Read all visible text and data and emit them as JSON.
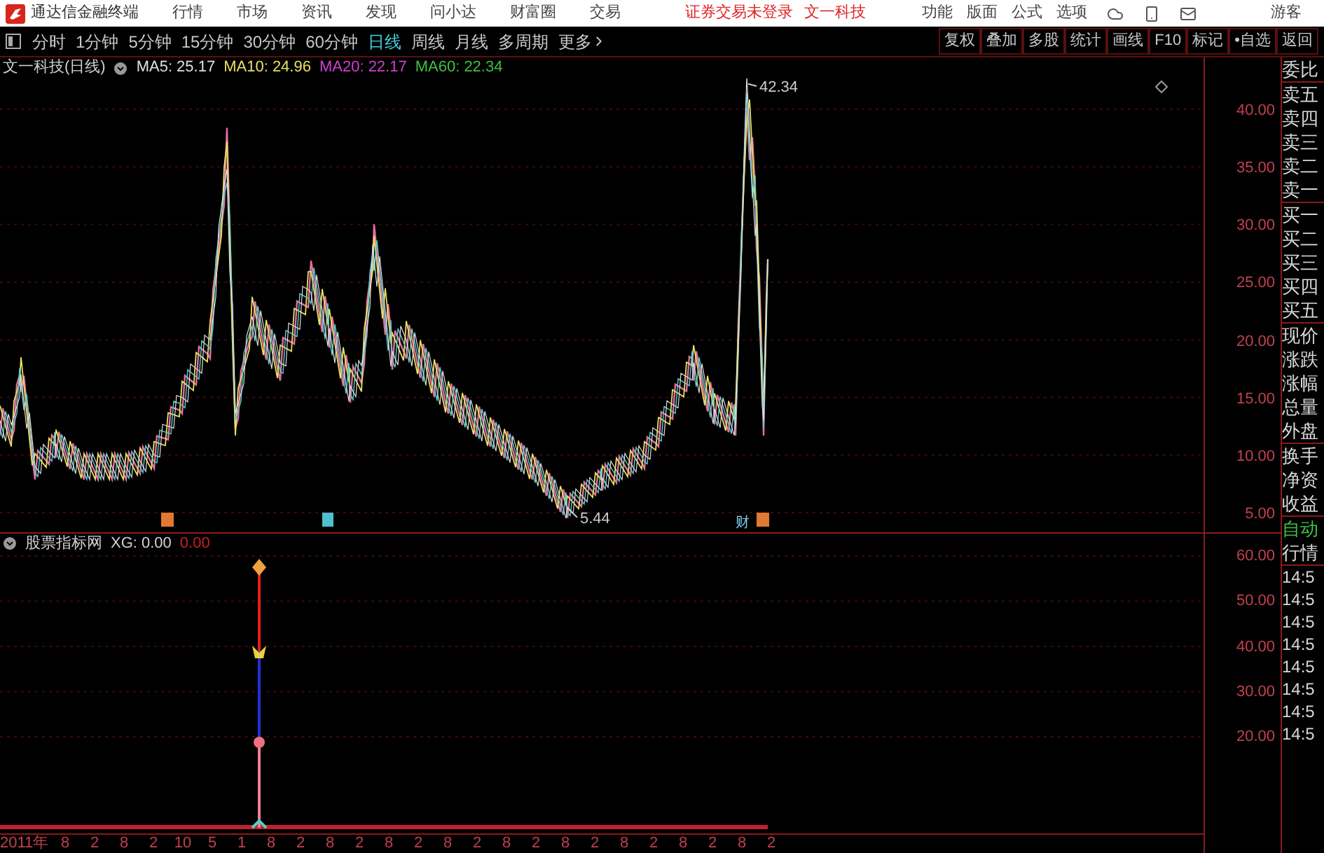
{
  "title_bar": {
    "app_name": "通达信金融终端",
    "menu": [
      "行情",
      "市场",
      "资讯",
      "发现",
      "问小达",
      "财富圈",
      "交易"
    ],
    "notice": "证券交易未登录",
    "stock": "文一科技",
    "tools": [
      "功能",
      "版面",
      "公式",
      "选项"
    ],
    "user": "游客"
  },
  "toolbar": {
    "periods": [
      {
        "label": "分时",
        "selected": false
      },
      {
        "label": "1分钟",
        "selected": false
      },
      {
        "label": "5分钟",
        "selected": false
      },
      {
        "label": "15分钟",
        "selected": false
      },
      {
        "label": "30分钟",
        "selected": false
      },
      {
        "label": "60分钟",
        "selected": false
      },
      {
        "label": "日线",
        "selected": true
      },
      {
        "label": "周线",
        "selected": false
      },
      {
        "label": "月线",
        "selected": false
      },
      {
        "label": "多周期",
        "selected": false
      }
    ],
    "more": "更多",
    "actions": [
      "复权",
      "叠加",
      "多股",
      "统计",
      "画线",
      "F10",
      "标记",
      "•自选",
      "返回"
    ]
  },
  "main_chart": {
    "title": "文一科技(日线)",
    "ma": [
      {
        "label": "MA5: 25.17",
        "color": "#e0e0e0"
      },
      {
        "label": "MA10: 24.96",
        "color": "#e8e060"
      },
      {
        "label": "MA20: 22.17",
        "color": "#d040d0"
      },
      {
        "label": "MA60: 22.34",
        "color": "#40c040"
      }
    ],
    "high_label": "42.34",
    "low_label": "5.44",
    "marker_text": "财",
    "y_ticks": [
      "40.00",
      "35.00",
      "30.00",
      "25.00",
      "20.00",
      "15.00",
      "10.00",
      "5.00"
    ]
  },
  "indicator": {
    "title": "股票指标网",
    "xg": "XG: 0.00",
    "value": "0.00",
    "y_ticks": [
      "60.00",
      "50.00",
      "40.00",
      "30.00",
      "20.00"
    ]
  },
  "time_axis": [
    "2011年",
    "8",
    "2",
    "8",
    "2",
    "10",
    "5",
    "1",
    "8",
    "2",
    "8",
    "2",
    "8",
    "2",
    "8",
    "2",
    "8",
    "2",
    "8",
    "2",
    "8",
    "2",
    "8",
    "2",
    "8",
    "2"
  ],
  "side_panel": {
    "quote_groups": [
      [
        "委比"
      ],
      [
        "卖五",
        "卖四",
        "卖三",
        "卖二",
        "卖一"
      ],
      [
        "买一",
        "买二",
        "买三",
        "买四",
        "买五"
      ],
      [
        "现价",
        "涨跌",
        "涨幅",
        "总量",
        "外盘"
      ],
      [
        "换手",
        "净资",
        "收益"
      ]
    ],
    "auto": "自动",
    "market": "行情",
    "times": [
      "14:5",
      "14:5",
      "14:5",
      "14:5",
      "14:5",
      "14:5",
      "14:5",
      "14:5"
    ]
  }
}
